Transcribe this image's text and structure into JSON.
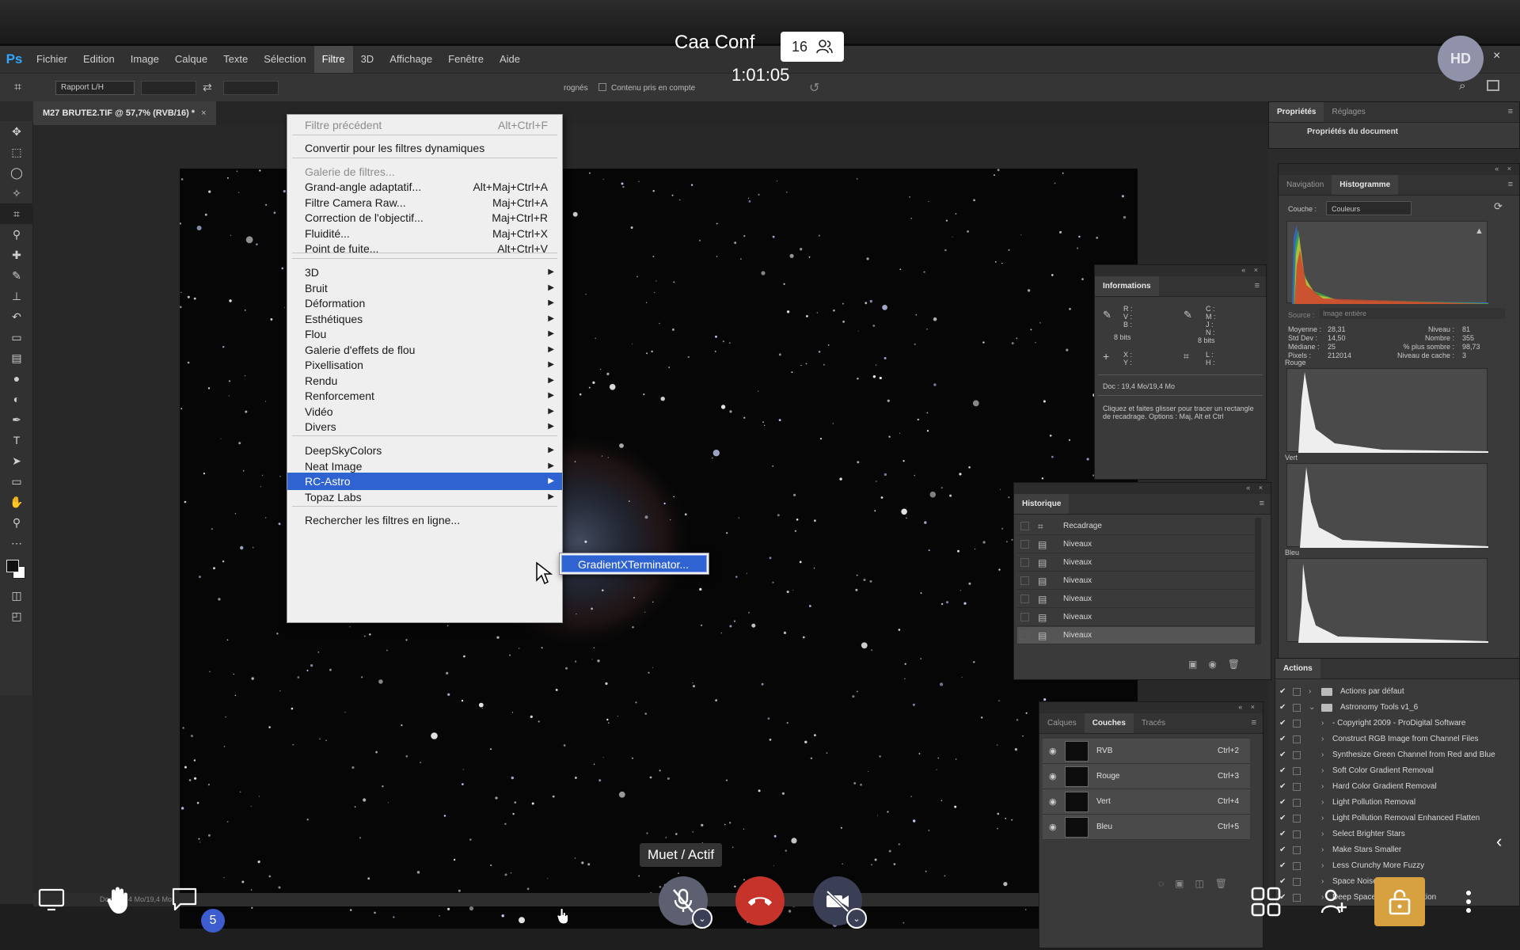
{
  "photoshop": {
    "logo": "Ps",
    "menu": [
      "Fichier",
      "Edition",
      "Image",
      "Calque",
      "Texte",
      "Sélection",
      "Filtre",
      "3D",
      "Affichage",
      "Fenêtre",
      "Aide"
    ],
    "options": {
      "ratio": "Rapport L/H",
      "delete_cropped": "rognés",
      "content_aware": "Contenu pris en compte"
    },
    "doc_tab": "M27 BRUTE2.TIF @ 57,7% (RVB/16) *",
    "status": "Doc : 19,4 Mo/19,4 Mo"
  },
  "filter_menu": {
    "items": [
      {
        "label": "Filtre précédent",
        "shortcut": "Alt+Ctrl+F",
        "disabled": true
      },
      {
        "label": "Convertir pour les filtres dynamiques",
        "shortcut": ""
      },
      {
        "label": "Galerie de filtres...",
        "shortcut": "",
        "disabled": true
      },
      {
        "label": "Grand-angle adaptatif...",
        "shortcut": "Alt+Maj+Ctrl+A"
      },
      {
        "label": "Filtre Camera Raw...",
        "shortcut": "Maj+Ctrl+A"
      },
      {
        "label": "Correction de l'objectif...",
        "shortcut": "Maj+Ctrl+R"
      },
      {
        "label": "Fluidité...",
        "shortcut": "Maj+Ctrl+X"
      },
      {
        "label": "Point de fuite...",
        "shortcut": "Alt+Ctrl+V"
      },
      {
        "label": "3D",
        "submenu": true
      },
      {
        "label": "Bruit",
        "submenu": true
      },
      {
        "label": "Déformation",
        "submenu": true
      },
      {
        "label": "Esthétiques",
        "submenu": true
      },
      {
        "label": "Flou",
        "submenu": true
      },
      {
        "label": "Galerie d'effets de flou",
        "submenu": true
      },
      {
        "label": "Pixellisation",
        "submenu": true
      },
      {
        "label": "Rendu",
        "submenu": true
      },
      {
        "label": "Renforcement",
        "submenu": true
      },
      {
        "label": "Vidéo",
        "submenu": true
      },
      {
        "label": "Divers",
        "submenu": true
      },
      {
        "label": "DeepSkyColors",
        "submenu": true
      },
      {
        "label": "Neat Image",
        "submenu": true
      },
      {
        "label": "RC-Astro",
        "submenu": true,
        "highlighted": true
      },
      {
        "label": "Topaz Labs",
        "submenu": true
      },
      {
        "label": "Rechercher les filtres en ligne...",
        "shortcut": ""
      }
    ],
    "submenu_item": "GradientXTerminator..."
  },
  "properties_panel": {
    "tabs": [
      "Propriétés",
      "Réglages"
    ],
    "doc_props": "Propriétés du document"
  },
  "histogram_panel": {
    "tabs": [
      "Navigation",
      "Histogramme"
    ],
    "channel_label": "Couche :",
    "channel_value": "Couleurs",
    "source_label": "Source :",
    "source_value": "Image entière",
    "stats_left": [
      {
        "k": "Moyenne :",
        "v": "28,31"
      },
      {
        "k": "Std Dev :",
        "v": "14,50"
      },
      {
        "k": "Médiane :",
        "v": "25"
      },
      {
        "k": "Pixels :",
        "v": "212014"
      }
    ],
    "stats_right": [
      {
        "k": "Niveau :",
        "v": "81"
      },
      {
        "k": "Nombre :",
        "v": "355"
      },
      {
        "k": "% plus sombre :",
        "v": "98,73"
      },
      {
        "k": "Niveau de cache :",
        "v": "3"
      }
    ],
    "channels": [
      "Rouge",
      "Vert",
      "Bleu"
    ]
  },
  "info_panel": {
    "title": "Informations",
    "rvb": [
      "R :",
      "V :",
      "B :"
    ],
    "cmjn": [
      "C :",
      "M :",
      "J :",
      "N :"
    ],
    "bits_left": "8 bits",
    "bits_right": "8 bits",
    "xy": [
      "X :",
      "Y :"
    ],
    "lh": [
      "L :",
      "H :"
    ],
    "doc": "Doc : 19,4 Mo/19,4 Mo",
    "hint": "Cliquez et faites glisser pour tracer un rectangle de recadrage. Options : Maj, Alt et Ctrl"
  },
  "history_panel": {
    "title": "Historique",
    "items": [
      "Recadrage",
      "Niveaux",
      "Niveaux",
      "Niveaux",
      "Niveaux",
      "Niveaux",
      "Niveaux"
    ]
  },
  "layers_panel": {
    "tabs": [
      "Calques",
      "Couches",
      "Tracés"
    ],
    "channels": [
      {
        "name": "RVB",
        "shortcut": "Ctrl+2"
      },
      {
        "name": "Rouge",
        "shortcut": "Ctrl+3"
      },
      {
        "name": "Vert",
        "shortcut": "Ctrl+4"
      },
      {
        "name": "Bleu",
        "shortcut": "Ctrl+5"
      }
    ]
  },
  "actions_panel": {
    "title": "Actions",
    "items": [
      {
        "label": "Actions par défaut",
        "level": 0,
        "folder": true
      },
      {
        "label": "Astronomy Tools v1_6",
        "level": 0,
        "folder": true,
        "open": true
      },
      {
        "label": "- Copyright 2009 - ProDigital Software",
        "level": 1
      },
      {
        "label": "Construct RGB Image from Channel Files",
        "level": 1
      },
      {
        "label": "Synthesize Green Channel from Red and Blue",
        "level": 1
      },
      {
        "label": "Soft Color Gradient Removal",
        "level": 1
      },
      {
        "label": "Hard Color Gradient Removal",
        "level": 1
      },
      {
        "label": "Light Pollution Removal",
        "level": 1
      },
      {
        "label": "Light Pollution Removal Enhanced Flatten",
        "level": 1
      },
      {
        "label": "Select Brighter Stars",
        "level": 1
      },
      {
        "label": "Make Stars Smaller",
        "level": 1
      },
      {
        "label": "Less Crunchy More Fuzzy",
        "level": 1
      },
      {
        "label": "Space Noise Reduction",
        "level": 1
      },
      {
        "label": "Deep Space Noise Reduction",
        "level": 1
      }
    ]
  },
  "conference": {
    "title": "Caa Conf",
    "participants": "16",
    "timer": "1:01:05",
    "avatar": "HD",
    "tooltip": "Muet / Actif",
    "chat_badge": "5",
    "colors": {
      "hangup": "#c5332b",
      "lock": "#d6a13e",
      "badge": "#3d5ccf"
    }
  }
}
